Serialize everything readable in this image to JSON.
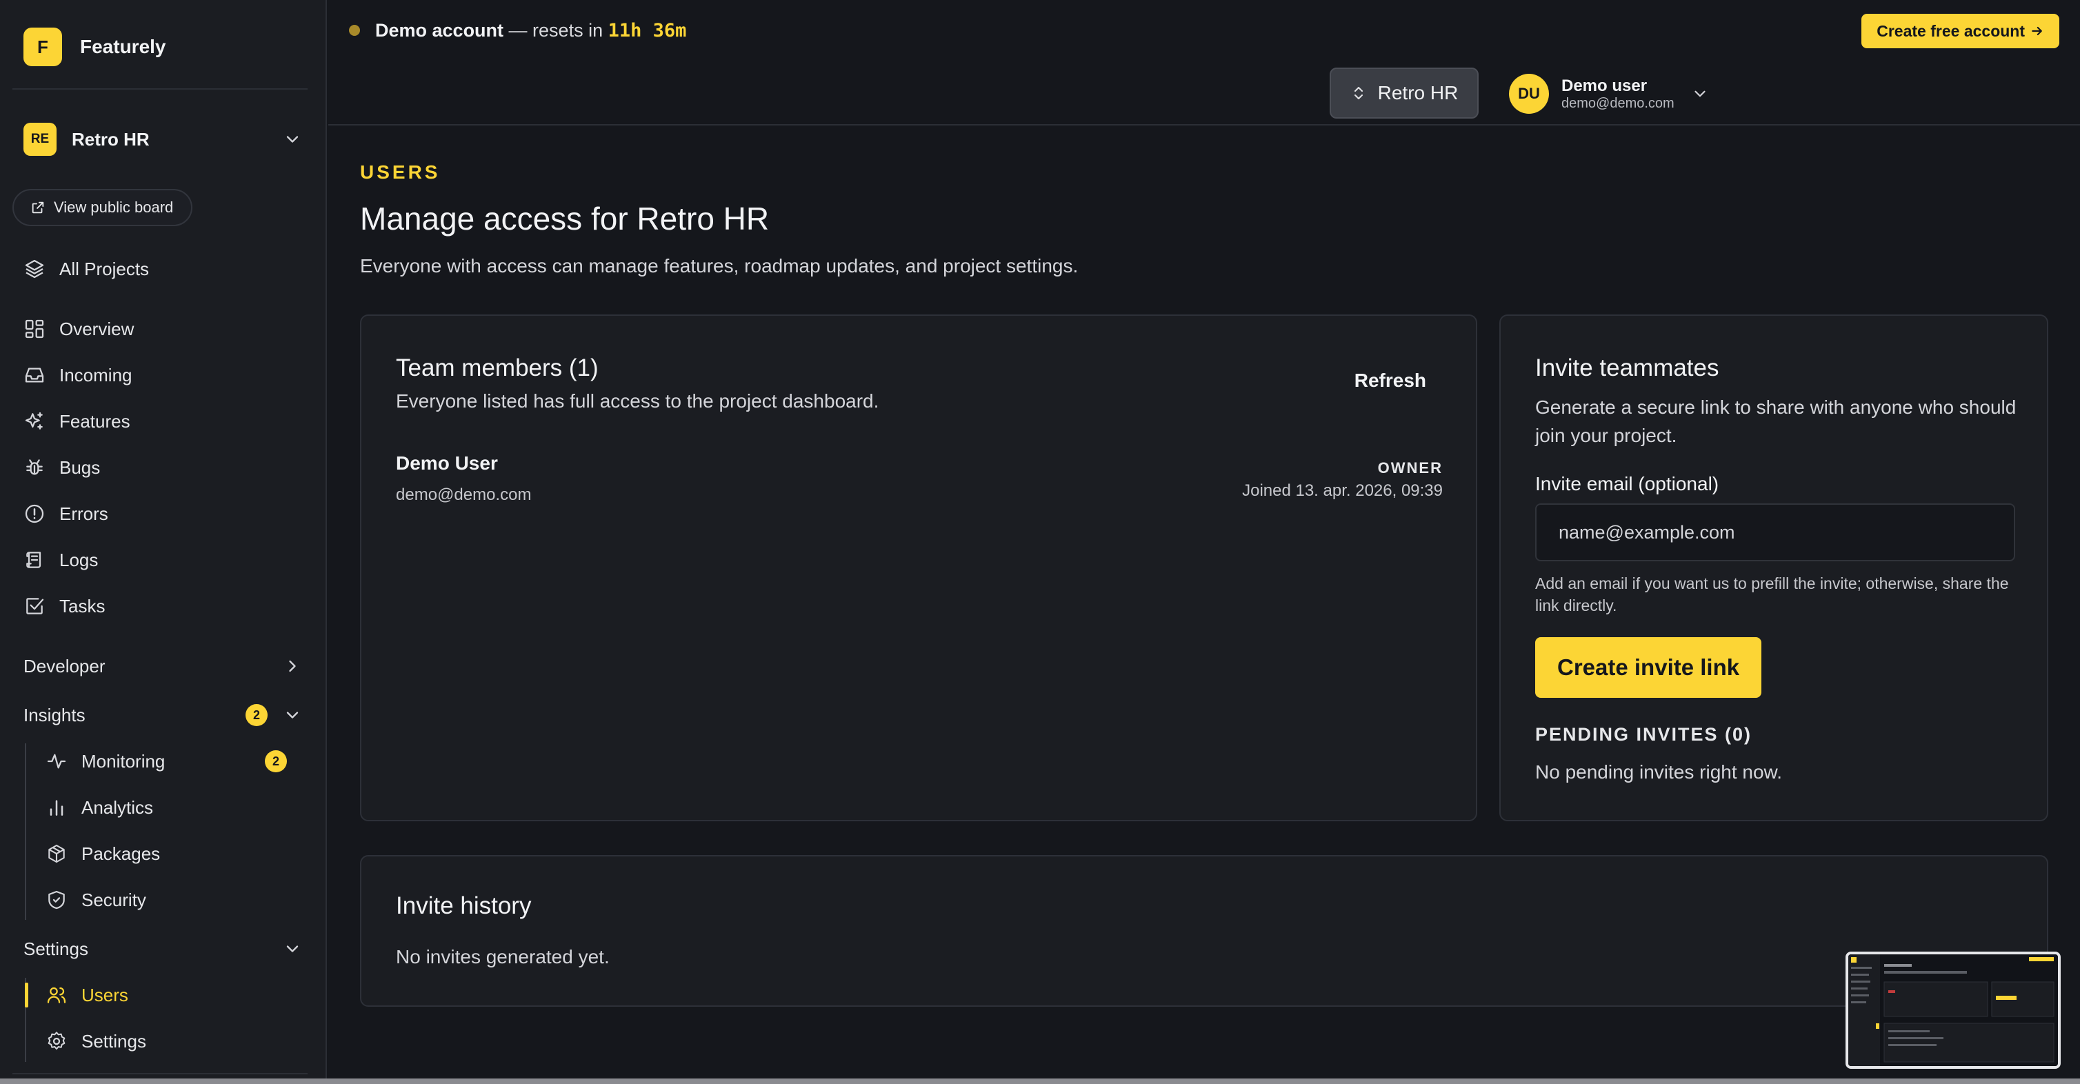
{
  "app": {
    "logo_letter": "F",
    "name": "Featurely"
  },
  "project": {
    "badge": "RE",
    "name": "Retro HR"
  },
  "sidebar": {
    "public_board": "View public board",
    "all_projects": "All Projects",
    "items": [
      {
        "label": "Overview",
        "icon": "grid-icon"
      },
      {
        "label": "Incoming",
        "icon": "inbox-icon"
      },
      {
        "label": "Features",
        "icon": "sparkles-icon"
      },
      {
        "label": "Bugs",
        "icon": "bug-icon"
      },
      {
        "label": "Errors",
        "icon": "alert-circle-icon"
      },
      {
        "label": "Logs",
        "icon": "scroll-icon"
      },
      {
        "label": "Tasks",
        "icon": "checkbox-icon"
      }
    ],
    "developer": "Developer",
    "insights": {
      "label": "Insights",
      "badge": "2",
      "items": [
        {
          "label": "Monitoring",
          "badge": "2",
          "icon": "activity-icon"
        },
        {
          "label": "Analytics",
          "icon": "bar-chart-icon"
        },
        {
          "label": "Packages",
          "icon": "package-icon"
        },
        {
          "label": "Security",
          "icon": "shield-icon"
        }
      ]
    },
    "settings": {
      "label": "Settings",
      "items": [
        {
          "label": "Users",
          "icon": "users-icon",
          "active": true
        },
        {
          "label": "Settings",
          "icon": "gear-icon"
        }
      ]
    }
  },
  "topbar": {
    "demo_label": "Demo account",
    "demo_text": " — resets in ",
    "timer": "11h 36m",
    "cta": "Create free account",
    "project_switcher": "Retro HR",
    "user": {
      "initials": "DU",
      "name": "Demo user",
      "email": "demo@demo.com"
    }
  },
  "page": {
    "eyebrow": "USERS",
    "title": "Manage access for Retro HR",
    "subtitle": "Everyone with access can manage features, roadmap updates, and project settings."
  },
  "team": {
    "title": "Team members (1)",
    "subtitle": "Everyone listed has full access to the project dashboard.",
    "refresh": "Refresh",
    "members": [
      {
        "name": "Demo User",
        "email": "demo@demo.com",
        "role": "OWNER",
        "joined": "Joined 13. apr. 2026, 09:39"
      }
    ]
  },
  "invite": {
    "title": "Invite teammates",
    "subtitle": "Generate a secure link to share with anyone who should join your project.",
    "email_label": "Invite email (optional)",
    "email_placeholder": "name@example.com",
    "help": "Add an email if you want us to prefill the invite; otherwise, share the link directly.",
    "button": "Create invite link",
    "pending_title": "PENDING INVITES (0)",
    "pending_empty": "No pending invites right now."
  },
  "history": {
    "title": "Invite history",
    "empty": "No invites generated yet."
  },
  "colors": {
    "accent": "#fcd535",
    "background": "#15171c",
    "surface": "#1b1d22"
  }
}
